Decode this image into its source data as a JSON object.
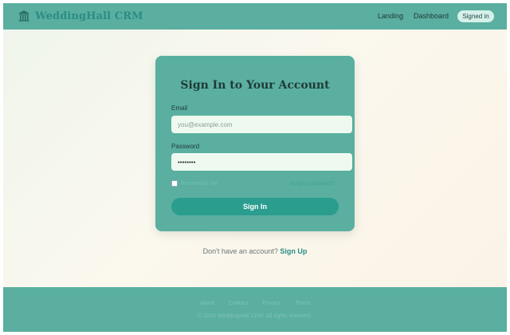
{
  "header": {
    "brand": "WeddingHall CRM",
    "brand_icon": "building-columns-icon",
    "nav": {
      "landing": "Landing",
      "dashboard": "Dashboard",
      "signed_in": "Signed in"
    }
  },
  "card": {
    "title": "Sign In to Your Account",
    "email_label": "Email",
    "email_placeholder": "you@example.com",
    "password_label": "Password",
    "password_value": "password",
    "remember_label": "Remember me",
    "forgot_label": "Forgot password?",
    "submit_label": "Sign In"
  },
  "signup": {
    "prompt": "Don't have an account?",
    "link": "Sign Up"
  },
  "footer": {
    "links": [
      "About",
      "Contact",
      "Privacy",
      "Terms"
    ],
    "copyright": "© 2024 WeddingHall CRM. All rights reserved."
  },
  "colors": {
    "teal": "#5aafa0",
    "button": "#2a9d8f",
    "brand": "#2a8e84",
    "input_bg": "#eefaf0"
  }
}
